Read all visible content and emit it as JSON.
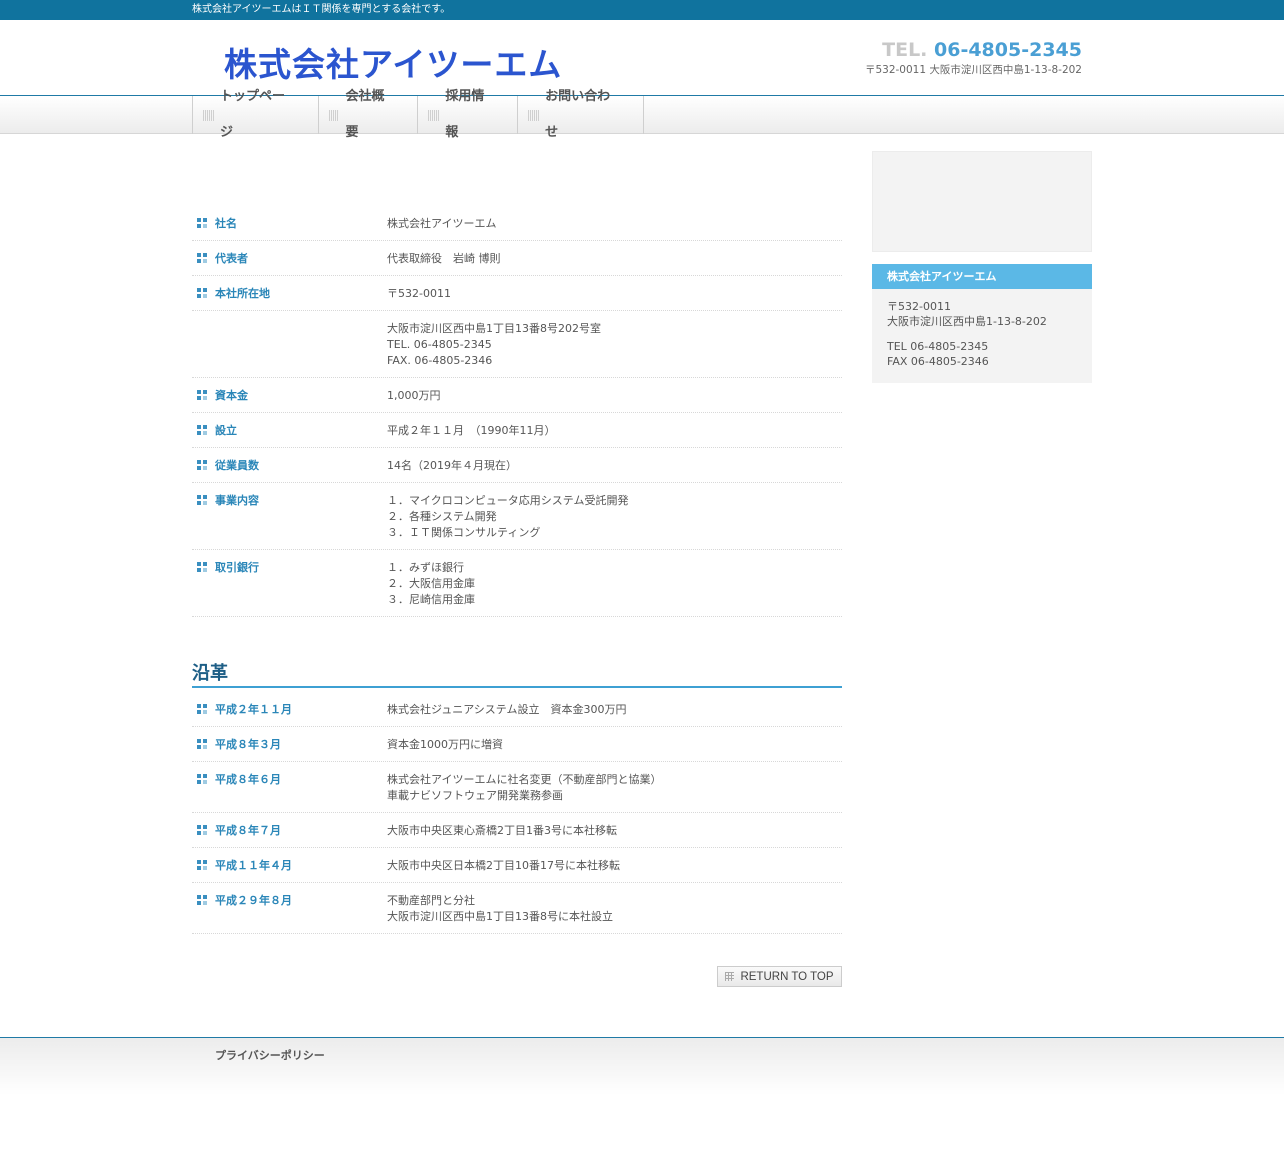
{
  "topbar": {
    "tagline": "株式会社アイツーエムはＩＴ関係を専門とする会社です。"
  },
  "header": {
    "logo": "株式会社アイツーエム",
    "tel_label": "TEL.",
    "tel_number": "06-4805-2345",
    "address": "〒532-0011 大阪市淀川区西中島1-13-8-202"
  },
  "nav": [
    {
      "label": "トップページ"
    },
    {
      "label": "会社概要"
    },
    {
      "label": "採用情報"
    },
    {
      "label": "お問い合わせ"
    }
  ],
  "company": {
    "rows": [
      {
        "label": "社名",
        "lines": [
          "株式会社アイツーエム"
        ]
      },
      {
        "label": "代表者",
        "lines": [
          "代表取締役　岩崎 博則"
        ]
      },
      {
        "label": "本社所在地",
        "lines": [
          "〒532-0011"
        ]
      },
      {
        "label": "",
        "lines": [
          "大阪市淀川区西中島1丁目13番8号202号室",
          "TEL. 06-4805-2345",
          "FAX. 06-4805-2346"
        ]
      },
      {
        "label": "資本金",
        "lines": [
          "1,000万円"
        ]
      },
      {
        "label": "設立",
        "lines": [
          "平成２年１１月　（1990年11月）"
        ]
      },
      {
        "label": "従業員数",
        "lines": [
          "14名（2019年４月現在）"
        ]
      },
      {
        "label": "事業内容",
        "lines": [
          "１．マイクロコンピュータ応用システム受託開発",
          "２．各種システム開発",
          "３．ＩＴ関係コンサルティング"
        ]
      },
      {
        "label": "取引銀行",
        "lines": [
          "１．みずほ銀行",
          "２．大阪信用金庫",
          "３．尼崎信用金庫"
        ]
      }
    ]
  },
  "history": {
    "title": "沿革",
    "rows": [
      {
        "label": "平成２年１１月",
        "lines": [
          "株式会社ジュニアシステム設立　資本金300万円"
        ]
      },
      {
        "label": "平成８年３月",
        "lines": [
          "資本金1000万円に増資"
        ]
      },
      {
        "label": "平成８年６月",
        "lines": [
          "株式会社アイツーエムに社名変更（不動産部門と協業）",
          "車載ナビソフトウェア開発業務参画"
        ]
      },
      {
        "label": "平成８年７月",
        "lines": [
          "大阪市中央区東心斎橋2丁目1番3号に本社移転"
        ]
      },
      {
        "label": "平成１１年４月",
        "lines": [
          "大阪市中央区日本橋2丁目10番17号に本社移転"
        ]
      },
      {
        "label": "平成２９年８月",
        "lines": [
          "不動産部門と分社",
          "大阪市淀川区西中島1丁目13番8号に本社設立"
        ]
      }
    ]
  },
  "return_to_top": "RETURN TO TOP",
  "sidebar": {
    "heading": "株式会社アイツーエム",
    "postal": "〒532-0011",
    "address": "大阪市淀川区西中島1-13-8-202",
    "tel": "TEL 06-4805-2345",
    "fax": "FAX 06-4805-2346"
  },
  "footer": {
    "privacy": "プライバシーポリシー"
  },
  "colors": {
    "topbar": "#10739e",
    "accent": "#2a86b8",
    "logo": "#2b55cf",
    "sidebar_head": "#5bb8e6"
  }
}
